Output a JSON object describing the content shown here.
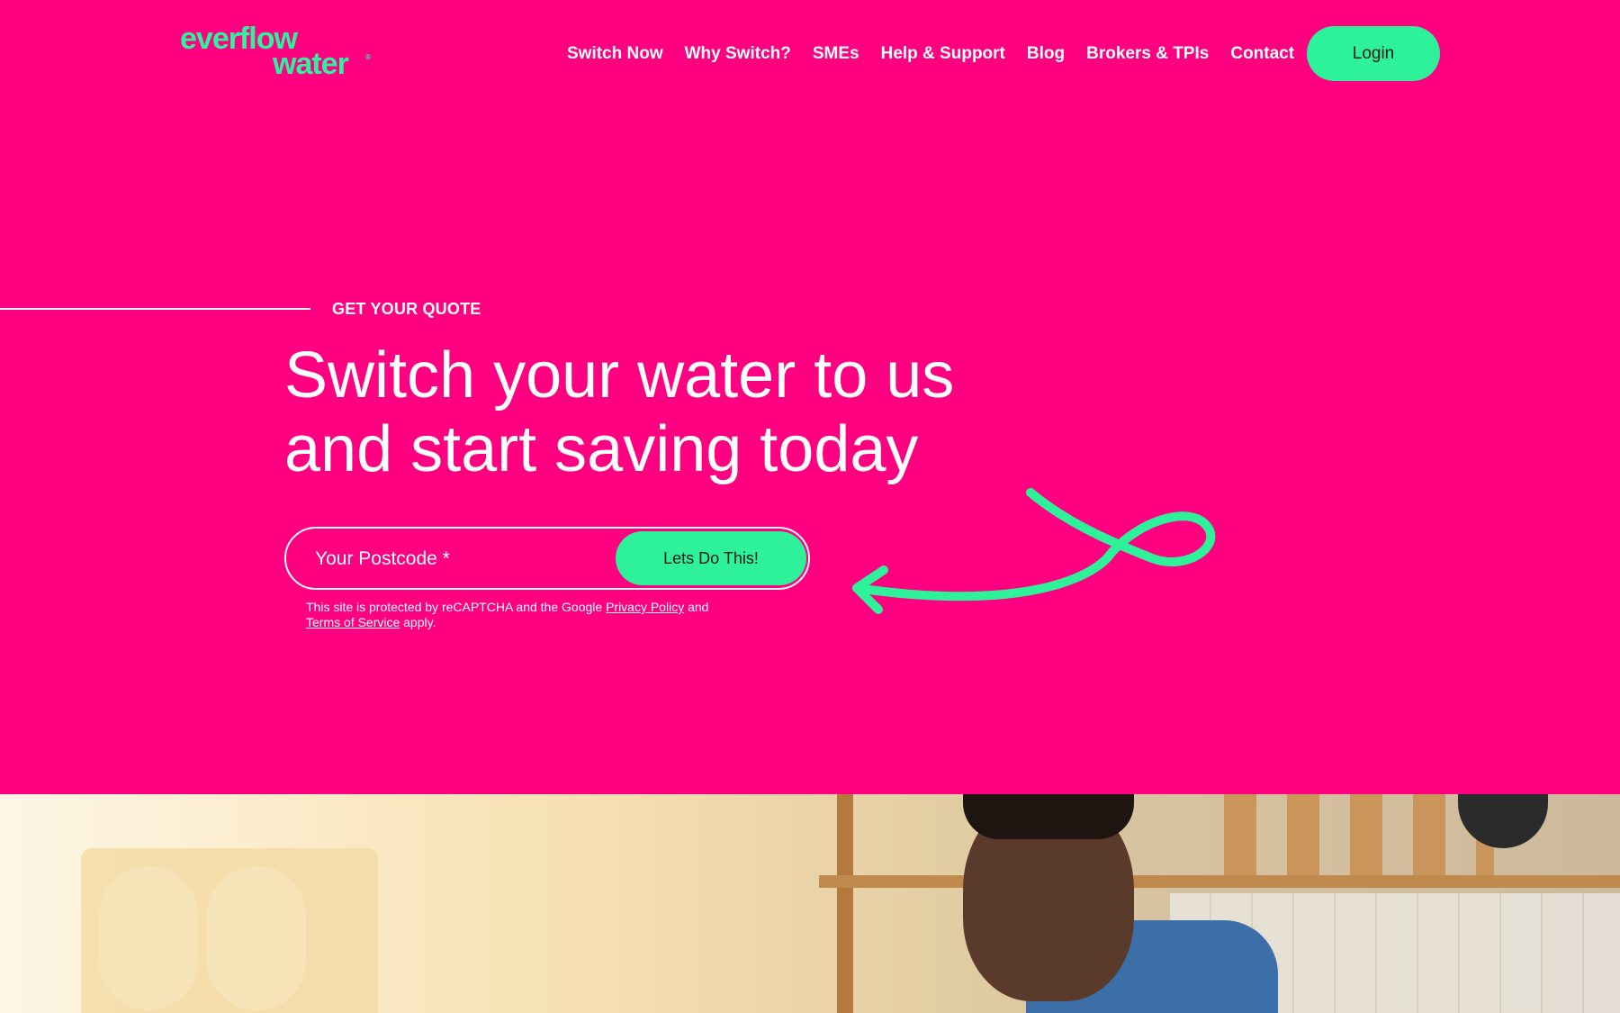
{
  "brand": {
    "logo_line1": "everflow",
    "logo_line2": "water",
    "logo_mark": "®",
    "accent_color": "#2ef29a",
    "background_color": "#ff0080"
  },
  "nav": {
    "items": [
      {
        "label": "Switch Now"
      },
      {
        "label": "Why Switch?"
      },
      {
        "label": "SMEs"
      },
      {
        "label": "Help & Support"
      },
      {
        "label": "Blog"
      },
      {
        "label": "Brokers & TPIs"
      },
      {
        "label": "Contact"
      }
    ],
    "login_label": "Login"
  },
  "hero": {
    "eyebrow": "GET YOUR QUOTE",
    "headline_line1": "Switch your water to us",
    "headline_line2": "and start saving today",
    "postcode_placeholder": "Your Postcode *",
    "postcode_value": "",
    "submit_label": "Lets Do This!",
    "recaptcha_prefix": "This site is protected by reCAPTCHA and the Google",
    "privacy_link": "Privacy Policy",
    "recaptcha_and": "and",
    "terms_link": "Terms of Service",
    "recaptcha_suffix": "apply."
  },
  "icons": {
    "arrow": "squiggle-arrow-icon"
  }
}
